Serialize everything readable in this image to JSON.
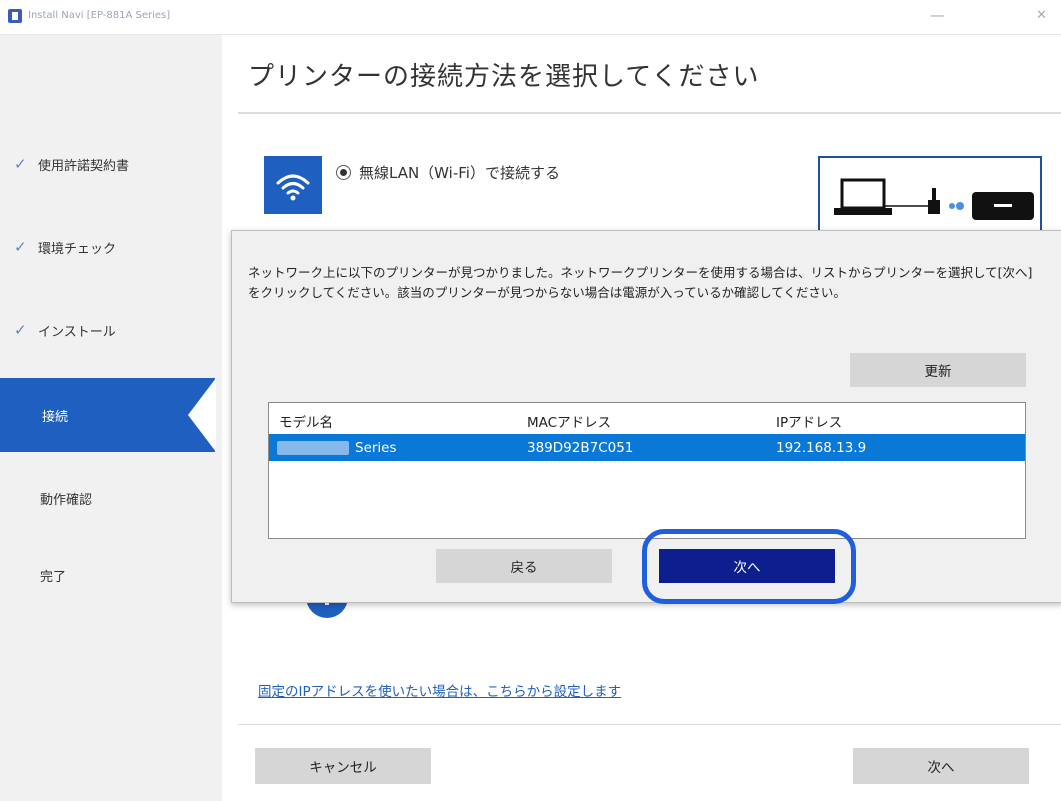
{
  "window": {
    "title": "Install Navi [EP-881A Series]",
    "minimize_glyph": "—",
    "close_glyph": "✕"
  },
  "sidebar": {
    "items": [
      {
        "label": "使用許諾契約書",
        "state": "done"
      },
      {
        "label": "環境チェック",
        "state": "done"
      },
      {
        "label": "インストール",
        "state": "done"
      },
      {
        "label": "接続",
        "state": "active"
      },
      {
        "label": "動作確認",
        "state": "pending"
      },
      {
        "label": "完了",
        "state": "pending"
      }
    ],
    "check_glyph": "✓"
  },
  "main": {
    "heading": "プリンターの接続方法を選択してください",
    "wifi_option": "無線LAN（Wi-Fi）で接続する",
    "static_ip_link": "固定のIPアドレスを使いたい場合は、こちらから設定します",
    "cancel_label": "キャンセル",
    "next_label": "次へ"
  },
  "dialog": {
    "message": "ネットワーク上に以下のプリンターが見つかりました。ネットワークプリンターを使用する場合は、リストからプリンターを選択して[次へ]をクリックしてください。該当のプリンターが見つからない場合は電源が入っているか確認してください。",
    "refresh_label": "更新",
    "columns": [
      "モデル名",
      "MACアドレス",
      "IPアドレス"
    ],
    "rows": [
      {
        "model": "Series",
        "mac": "389D92B7C051",
        "ip": "192.168.13.9",
        "selected": true
      }
    ],
    "back_label": "戻る",
    "next_label": "次へ"
  },
  "colors": {
    "accent": "#1f5fbf",
    "selection": "#0a78d7",
    "primary_button": "#0d1f8f",
    "highlight_ring": "#1f5fdd"
  },
  "icons": [
    "app-icon",
    "check-icon",
    "wifi-icon",
    "laptop-icon",
    "router-icon",
    "printer-icon",
    "info-icon"
  ]
}
